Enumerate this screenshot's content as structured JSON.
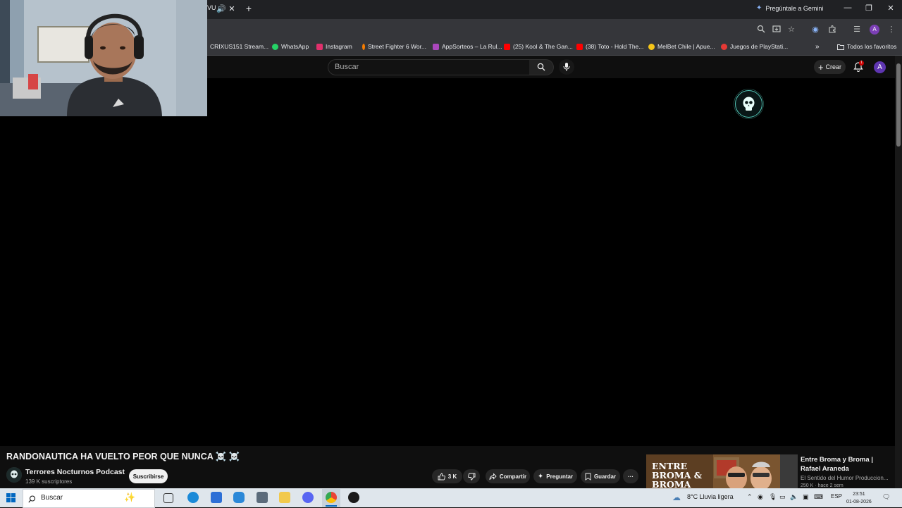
{
  "browser": {
    "tab_partial_title": "VU",
    "gemini_label": "Pregúntale a Gemini",
    "profile_initial": "A"
  },
  "bookmarks": [
    {
      "label": "CRIXUS151 Stream...",
      "icon": "stream-icon",
      "color": "#9146ff"
    },
    {
      "label": "WhatsApp",
      "icon": "whatsapp-icon",
      "color": "#25d366"
    },
    {
      "label": "Instagram",
      "icon": "instagram-icon",
      "color": "#e1306c"
    },
    {
      "label": "Street Fighter 6 Wor...",
      "icon": "sf6-icon",
      "color": "#f57c00"
    },
    {
      "label": "AppSorteos – La Rul...",
      "icon": "appsorteos-icon",
      "color": "#ab47bc"
    },
    {
      "label": "(25) Kool & The Gan...",
      "icon": "youtube-icon",
      "color": "#ff0000"
    },
    {
      "label": "(38) Toto - Hold The...",
      "icon": "youtube-icon",
      "color": "#ff0000"
    },
    {
      "label": "MelBet Chile | Apue...",
      "icon": "melbet-icon",
      "color": "#f5c518"
    },
    {
      "label": "Juegos de PlayStati...",
      "icon": "playstation-icon",
      "color": "#e53935"
    }
  ],
  "all_favorites": "Todos los favoritos",
  "youtube": {
    "search_placeholder": "Buscar",
    "create_label": "Crear",
    "notification_count": "1",
    "avatar_initial": "A"
  },
  "video": {
    "title": "RANDONAUTICA HA VUELTO PEOR QUE NUNCA ☠️ ☠️",
    "channel": "Terrores Nocturnos Podcast",
    "subscribers": "139 K suscriptores",
    "subscribe_label": "Suscribirse",
    "likes": "3 K",
    "share_label": "Compartir",
    "ask_label": "Preguntar",
    "save_label": "Guardar",
    "more_label": "···"
  },
  "recommended": {
    "thumb_text": "ENTRE BROMA & BROMA",
    "title": "Entre Broma y Broma | Rafael Araneda",
    "channel": "El Sentido del Humor Produccion...",
    "meta": "250 K · hace 2 sem"
  },
  "taskbar": {
    "search_label": "Buscar",
    "weather": "8°C  Lluvia ligera",
    "language": "ESP",
    "time": "23:51",
    "date": "01-08-2026"
  }
}
